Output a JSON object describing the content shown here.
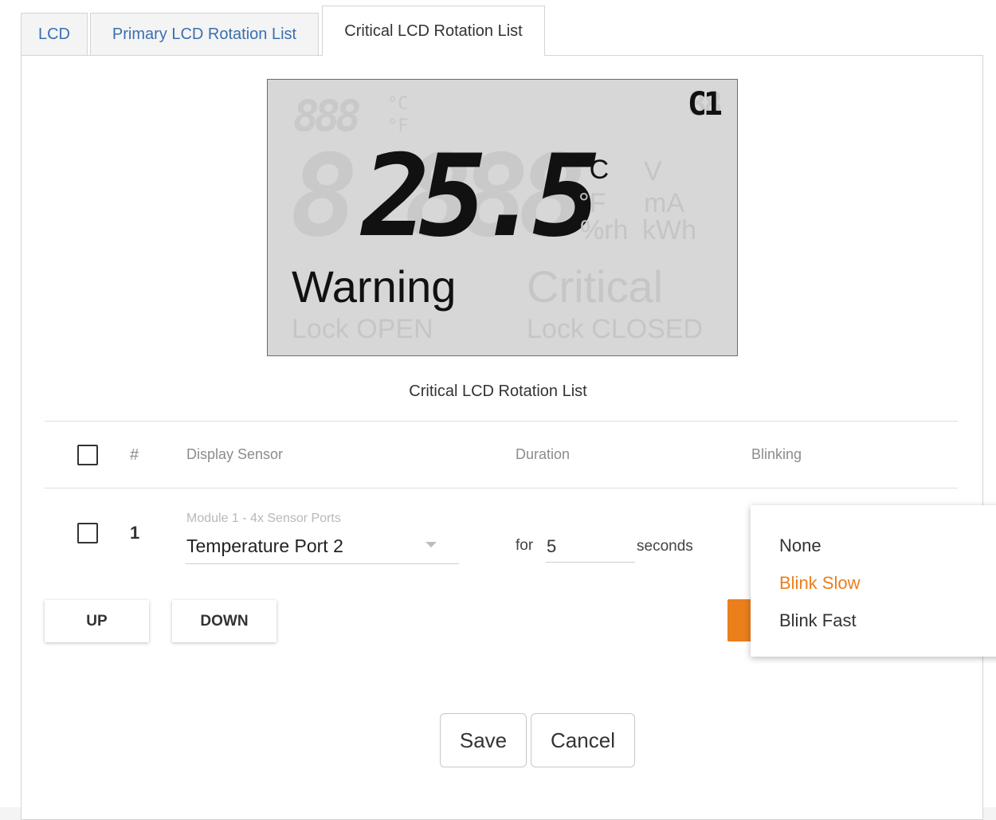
{
  "tabs": [
    {
      "label": "LCD"
    },
    {
      "label": "Primary LCD Rotation List"
    },
    {
      "label": "Critical LCD Rotation List"
    }
  ],
  "lcd": {
    "small_ghost_digits": "888",
    "small_units": [
      "°C",
      "°F"
    ],
    "corner_text": "C1",
    "corner_ghost": "88",
    "big_ghost_digits": "8.888",
    "value": "25.5",
    "active_unit": "°C",
    "ghost_units": [
      "°F",
      "%rh",
      "V",
      "mA",
      "kWh"
    ],
    "warning_label": "Warning",
    "critical_label": "Critical",
    "lock_open_label": "Lock OPEN",
    "lock_closed_label": "Lock CLOSED"
  },
  "caption": "Critical LCD Rotation List",
  "table": {
    "headers": {
      "number": "#",
      "sensor": "Display Sensor",
      "duration": "Duration",
      "blinking": "Blinking"
    },
    "rows": [
      {
        "number": "1",
        "sensor_helper": "Module 1 - 4x Sensor Ports",
        "sensor": "Temperature Port 2",
        "for_label": "for",
        "duration": "5",
        "seconds_label": "seconds"
      }
    ]
  },
  "buttons": {
    "up": "UP",
    "down": "DOWN",
    "save": "Save",
    "cancel": "Cancel"
  },
  "blink_menu": {
    "options": [
      "None",
      "Blink Slow",
      "Blink Fast"
    ],
    "selected": "Blink Slow"
  },
  "colors": {
    "accent": "#ea7f1c",
    "tab_link": "#3a6fb0",
    "lcd_bg": "#d7d7d7"
  }
}
